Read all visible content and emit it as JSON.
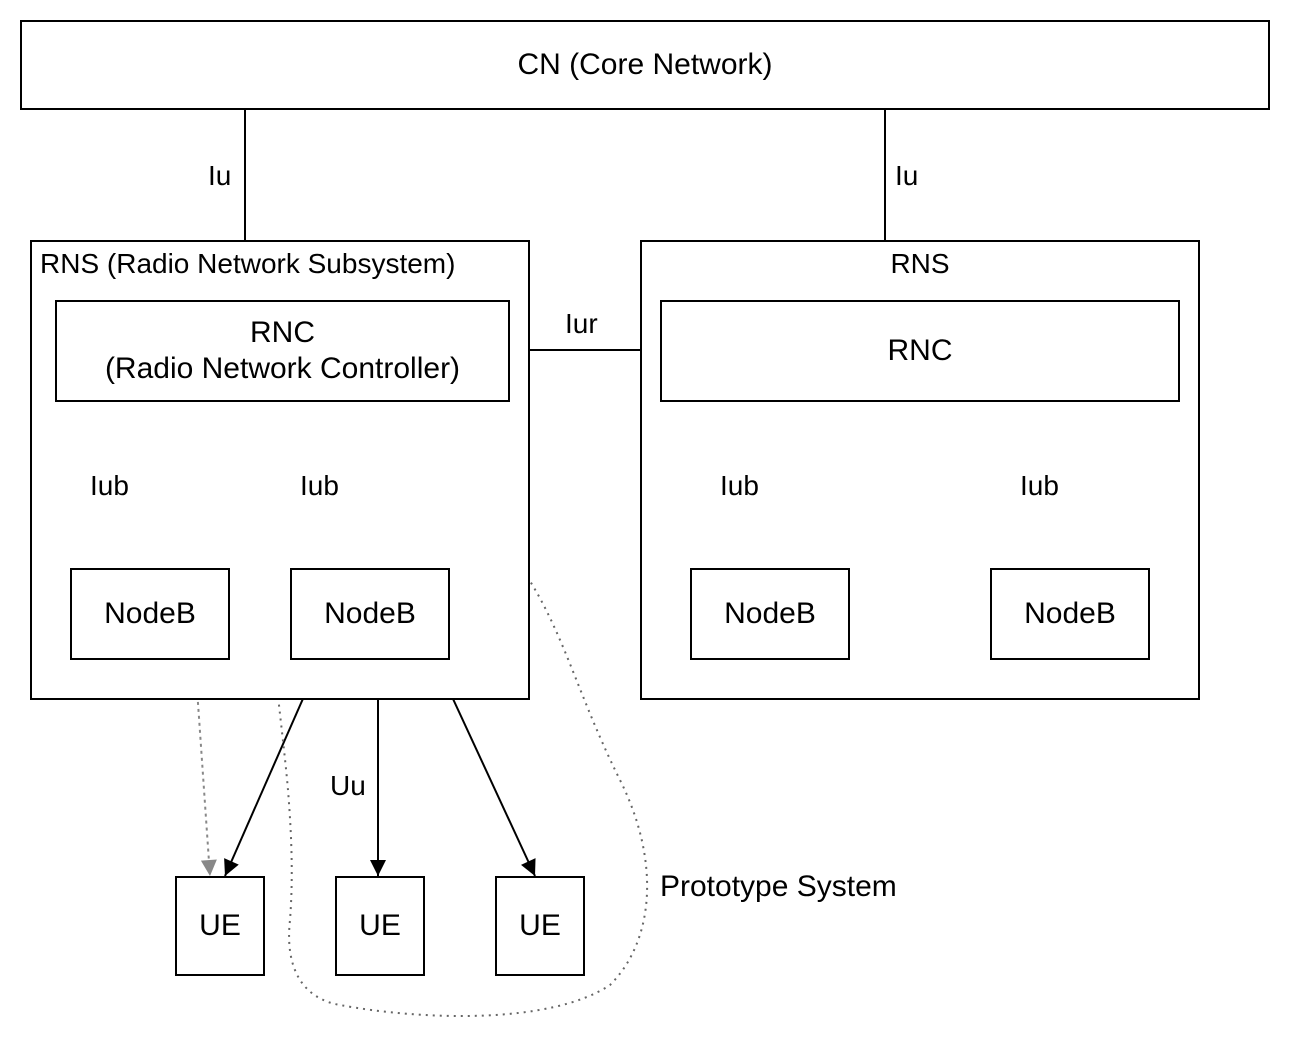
{
  "diagram": {
    "cn": {
      "label": "CN (Core Network)"
    },
    "rns_left": {
      "title": "RNS (Radio Network Subsystem)",
      "rnc": {
        "label_line1": "RNC",
        "label_line2": "(Radio Network Controller)"
      },
      "nodeB_left": {
        "label": "NodeB"
      },
      "nodeB_right": {
        "label": "NodeB"
      }
    },
    "rns_right": {
      "title": "RNS",
      "rnc": {
        "label": "RNC"
      },
      "nodeB_left": {
        "label": "NodeB"
      },
      "nodeB_right": {
        "label": "NodeB"
      }
    },
    "ue": {
      "ue1": {
        "label": "UE"
      },
      "ue2": {
        "label": "UE"
      },
      "ue3": {
        "label": "UE"
      }
    },
    "interfaces": {
      "iu_left": "Iu",
      "iu_right": "Iu",
      "iur": "Iur",
      "iub_left_1": "Iub",
      "iub_left_2": "Iub",
      "iub_right_1": "Iub",
      "iub_right_2": "Iub",
      "uu": "Uu"
    },
    "annotation": {
      "prototype": "Prototype System"
    }
  }
}
